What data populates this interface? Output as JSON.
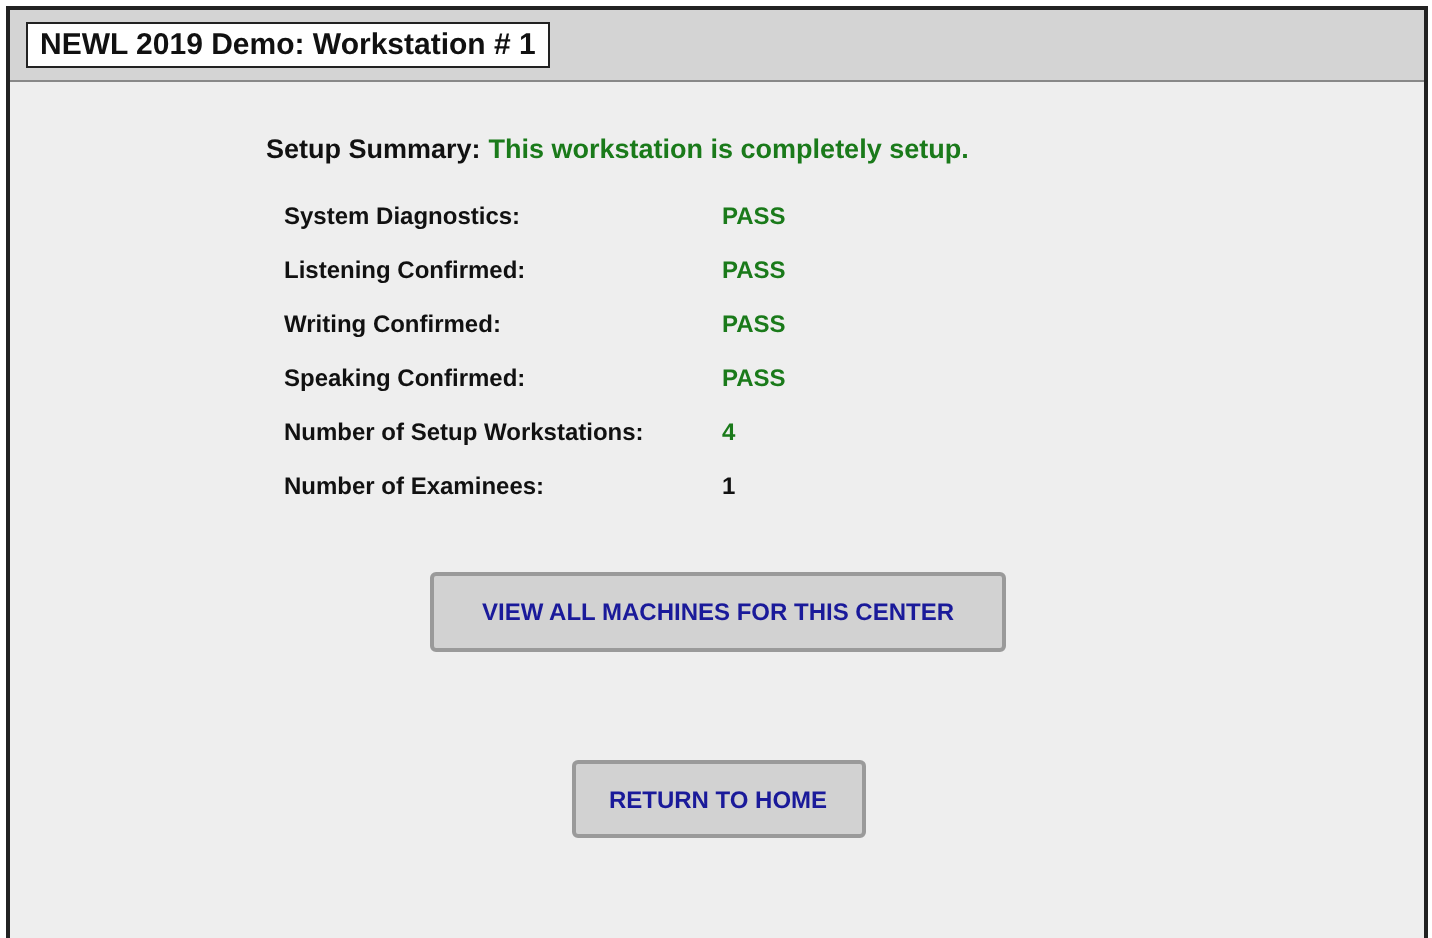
{
  "window": {
    "title": "NEWL 2019 Demo: Workstation # 1"
  },
  "summary": {
    "label": "Setup Summary:",
    "message": "This workstation is completely setup."
  },
  "rows": [
    {
      "label": "System Diagnostics:",
      "value": "PASS",
      "color": "#1a7a1a"
    },
    {
      "label": "Listening Confirmed:",
      "value": "PASS",
      "color": "#1a7a1a"
    },
    {
      "label": "Writing Confirmed:",
      "value": "PASS",
      "color": "#1a7a1a"
    },
    {
      "label": "Speaking Confirmed:",
      "value": "PASS",
      "color": "#1a7a1a"
    },
    {
      "label": "Number of Setup Workstations:",
      "value": "4",
      "color": "#1a7a1a"
    },
    {
      "label": "Number of Examinees:",
      "value": "1",
      "color": "#111111"
    }
  ],
  "buttons": [
    "VIEW ALL MACHINES FOR THIS CENTER",
    "RETURN TO HOME"
  ]
}
